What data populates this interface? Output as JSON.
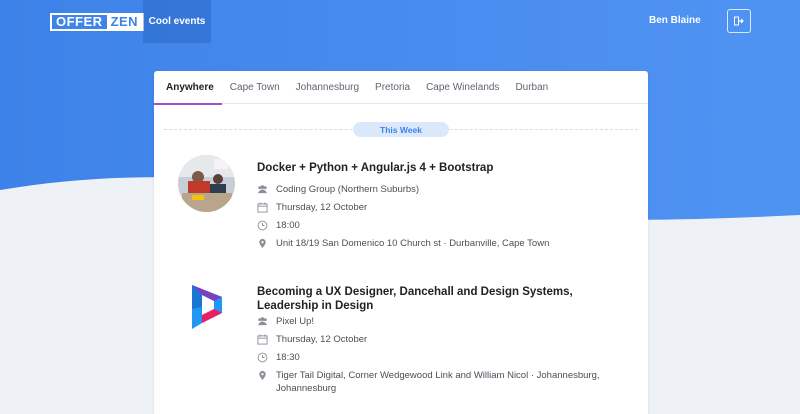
{
  "header": {
    "logo_left": "OFFER",
    "logo_right": "ZEN",
    "nav_active": "Cool events",
    "user_name": "Ben Blaine"
  },
  "tabs": [
    "Anywhere",
    "Cape Town",
    "Johannesburg",
    "Pretoria",
    "Cape Winelands",
    "Durban"
  ],
  "section_label": "This Week",
  "events": [
    {
      "title": "Docker + Python + Angular.js 4 + Bootstrap",
      "group": "Coding Group (Northern Suburbs)",
      "date": "Thursday, 12 October",
      "time": "18:00",
      "location": "Unit 18/19 San Domenico 10 Church st · Durbanville, Cape Town"
    },
    {
      "title": "Becoming a UX Designer, Dancehall and Design Systems, Leadership in Design",
      "group": "Pixel Up!",
      "date": "Thursday, 12 October",
      "time": "18:30",
      "location": "Tiger Tail Digital, Corner Wedgewood Link and William Nicol · Johannesburg, Johannesburg"
    }
  ],
  "colors": {
    "brand_blue": "#3d82e8",
    "tab_underline": "#a14fd0",
    "pill_bg": "#dbe8fb"
  }
}
